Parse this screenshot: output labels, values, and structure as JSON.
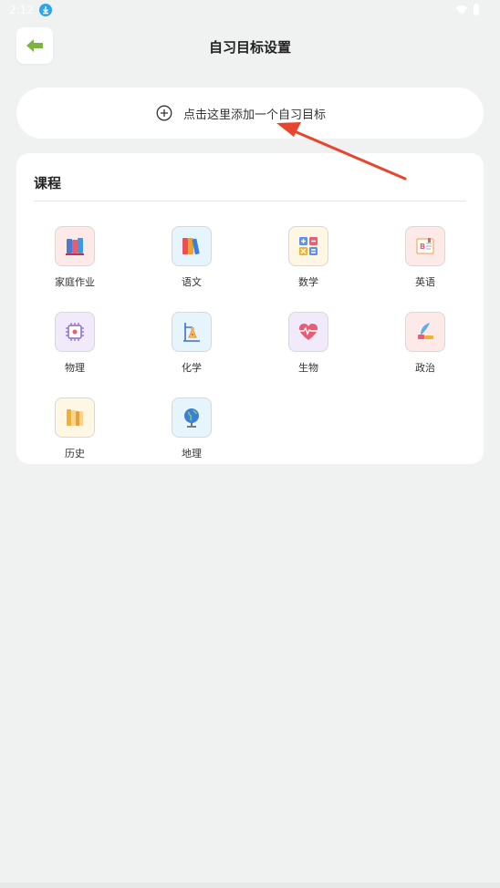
{
  "status_bar": {
    "time": "2:12"
  },
  "header": {
    "title": "自习目标设置"
  },
  "add_goal": {
    "label": "点击这里添加一个自习目标"
  },
  "courses": {
    "heading": "课程",
    "items": [
      {
        "label": "家庭作业",
        "icon": "homework-books-icon",
        "bg": "#fde9e7"
      },
      {
        "label": "语文",
        "icon": "chinese-books-icon",
        "bg": "#e6f4fb"
      },
      {
        "label": "数学",
        "icon": "math-calculator-icon",
        "bg": "#fff6e3"
      },
      {
        "label": "英语",
        "icon": "english-book-icon",
        "bg": "#fde9e7"
      },
      {
        "label": "物理",
        "icon": "physics-chip-icon",
        "bg": "#f1eafb"
      },
      {
        "label": "化学",
        "icon": "chemistry-flask-icon",
        "bg": "#e6f4fb"
      },
      {
        "label": "生物",
        "icon": "biology-heart-icon",
        "bg": "#f1eafb"
      },
      {
        "label": "政治",
        "icon": "politics-quill-icon",
        "bg": "#fde9e7"
      },
      {
        "label": "历史",
        "icon": "history-scroll-icon",
        "bg": "#fff6e3"
      },
      {
        "label": "地理",
        "icon": "geography-globe-icon",
        "bg": "#e6f4fb"
      }
    ]
  },
  "colors": {
    "accent_green": "#7cb342",
    "arrow_red": "#e8452e"
  }
}
